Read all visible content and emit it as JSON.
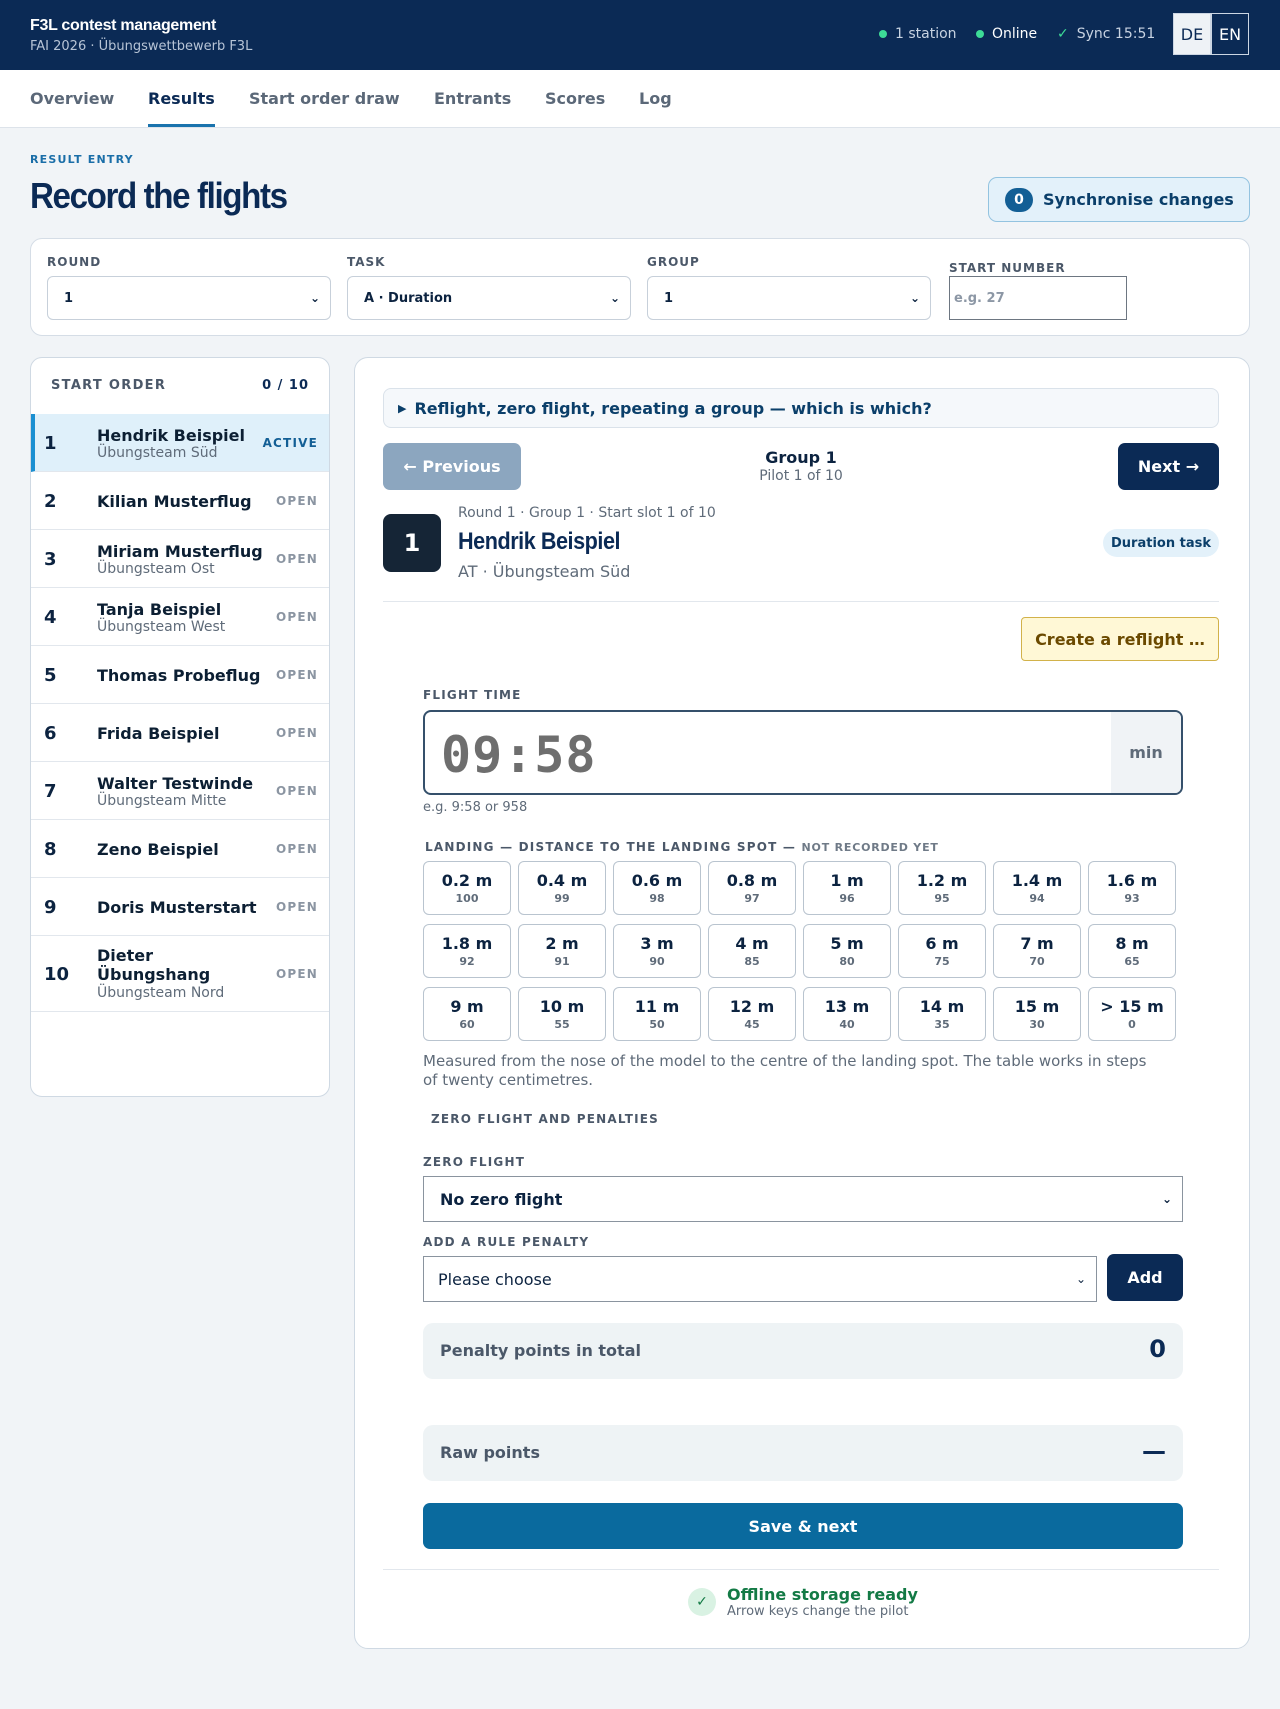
{
  "header": {
    "title": "F3L contest management",
    "subtitle": "FAI 2026 · Übungswettbewerb F3L",
    "stations": "1 station",
    "online": "Online",
    "sync": "Sync 15:51",
    "lang_de": "DE",
    "lang_en": "EN",
    "status_color": "#3ddc97"
  },
  "tabs": [
    "Overview",
    "Results",
    "Start order draw",
    "Entrants",
    "Scores",
    "Log"
  ],
  "active_tab": "Results",
  "page": {
    "eyebrow": "RESULT ENTRY",
    "title": "Record the flights",
    "sync_count": "0",
    "sync_label": "Synchronise changes"
  },
  "filters": {
    "round_label": "ROUND",
    "round_value": "1",
    "task_label": "TASK",
    "task_value": "A · Duration",
    "group_label": "GROUP",
    "group_value": "1",
    "start_label": "START NUMBER",
    "start_placeholder": "e.g. 27"
  },
  "start_order": {
    "title": "START ORDER",
    "count": "0 / 10",
    "items": [
      {
        "num": "1",
        "name": "Hendrik Beispiel",
        "team": "Übungsteam Süd",
        "state": "ACTIVE"
      },
      {
        "num": "2",
        "name": "Kilian Musterflug",
        "team": "",
        "state": "OPEN"
      },
      {
        "num": "3",
        "name": "Miriam Musterflug",
        "team": "Übungsteam Ost",
        "state": "OPEN"
      },
      {
        "num": "4",
        "name": "Tanja Beispiel",
        "team": "Übungsteam West",
        "state": "OPEN"
      },
      {
        "num": "5",
        "name": "Thomas Probeflug",
        "team": "",
        "state": "OPEN"
      },
      {
        "num": "6",
        "name": "Frida Beispiel",
        "team": "",
        "state": "OPEN"
      },
      {
        "num": "7",
        "name": "Walter Testwinde",
        "team": "Übungsteam Mitte",
        "state": "OPEN"
      },
      {
        "num": "8",
        "name": "Zeno Beispiel",
        "team": "",
        "state": "OPEN"
      },
      {
        "num": "9",
        "name": "Doris Musterstart",
        "team": "",
        "state": "OPEN"
      },
      {
        "num": "10",
        "name": "Dieter Übungshang",
        "team": "Übungsteam Nord",
        "state": "OPEN"
      }
    ]
  },
  "entry": {
    "faq": "Reflight, zero flight, repeating a group — which is which?",
    "prev": "← Previous",
    "next": "Next →",
    "group_title": "Group 1",
    "group_sub": "Pilot 1 of 10",
    "pilot_num": "1",
    "pilot_meta": "Round 1 · Group 1 · Start slot 1 of 10",
    "pilot_name": "Hendrik Beispiel",
    "pilot_team": "AT · Übungsteam Süd",
    "task_chip": "Duration task",
    "reflight": "Create a reflight …",
    "flight_time_label": "FLIGHT TIME",
    "flight_time": "09:58",
    "flight_unit": "min",
    "flight_hint": "e.g. 9:58 or 958",
    "landing_label": "LANDING — DISTANCE TO THE LANDING SPOT —",
    "landing_status": "NOT RECORDED YET",
    "landing": [
      {
        "dist": "0.2 m",
        "pts": "100"
      },
      {
        "dist": "0.4 m",
        "pts": "99"
      },
      {
        "dist": "0.6 m",
        "pts": "98"
      },
      {
        "dist": "0.8 m",
        "pts": "97"
      },
      {
        "dist": "1 m",
        "pts": "96"
      },
      {
        "dist": "1.2 m",
        "pts": "95"
      },
      {
        "dist": "1.4 m",
        "pts": "94"
      },
      {
        "dist": "1.6 m",
        "pts": "93"
      },
      {
        "dist": "1.8 m",
        "pts": "92"
      },
      {
        "dist": "2 m",
        "pts": "91"
      },
      {
        "dist": "3 m",
        "pts": "90"
      },
      {
        "dist": "4 m",
        "pts": "85"
      },
      {
        "dist": "5 m",
        "pts": "80"
      },
      {
        "dist": "6 m",
        "pts": "75"
      },
      {
        "dist": "7 m",
        "pts": "70"
      },
      {
        "dist": "8 m",
        "pts": "65"
      },
      {
        "dist": "9 m",
        "pts": "60"
      },
      {
        "dist": "10 m",
        "pts": "55"
      },
      {
        "dist": "11 m",
        "pts": "50"
      },
      {
        "dist": "12 m",
        "pts": "45"
      },
      {
        "dist": "13 m",
        "pts": "40"
      },
      {
        "dist": "14 m",
        "pts": "35"
      },
      {
        "dist": "15 m",
        "pts": "30"
      },
      {
        "dist": "> 15 m",
        "pts": "0"
      }
    ],
    "landing_note": "Measured from the nose of the model to the centre of the landing spot. The table works in steps of twenty centimetres.",
    "zero_section": "ZERO FLIGHT AND PENALTIES",
    "zero_label": "ZERO FLIGHT",
    "zero_value": "No zero flight",
    "penalty_label": "ADD A RULE PENALTY",
    "penalty_value": "Please choose",
    "add": "Add",
    "penalty_total_label": "Penalty points in total",
    "penalty_total": "0",
    "raw_label": "Raw points",
    "raw_value": "—",
    "save": "Save & next",
    "offline_title": "Offline storage ready",
    "offline_sub": "Arrow keys change the pilot"
  }
}
